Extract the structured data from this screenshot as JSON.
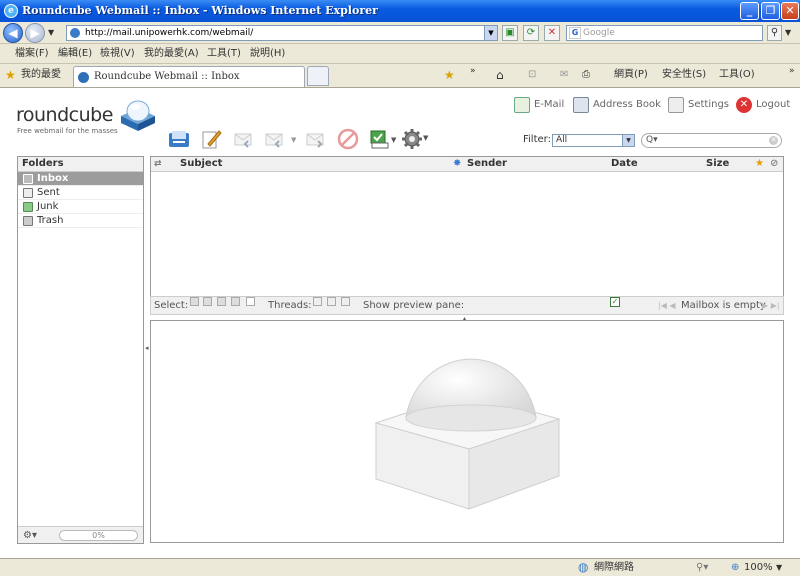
{
  "window": {
    "title": "Roundcube Webmail :: Inbox - Windows Internet Explorer",
    "url": "http://mail.unipowerhk.com/webmail/",
    "search_placeholder": "Google"
  },
  "menu": [
    "檔案(F)",
    "編輯(E)",
    "檢視(V)",
    "我的最愛(A)",
    "工具(T)",
    "說明(H)"
  ],
  "tabs_bar": {
    "favorites_label": "我的最愛",
    "tab_title": "Roundcube Webmail :: Inbox",
    "page_menu": "網頁(P)",
    "safety_menu": "安全性(S)",
    "tools_menu": "工具(O)"
  },
  "app": {
    "logo_name": "roundcube",
    "logo_tagline": "Free webmail for the masses",
    "top_links": {
      "email": "E-Mail",
      "address_book": "Address Book",
      "settings": "Settings",
      "logout": "Logout"
    },
    "filter_label": "Filter:",
    "filter_value": "All",
    "search_value": "Q▾"
  },
  "folders": {
    "header": "Folders",
    "items": [
      {
        "label": "Inbox",
        "selected": true,
        "icon": "inbox-icon"
      },
      {
        "label": "Sent",
        "selected": false,
        "icon": "sent-icon"
      },
      {
        "label": "Junk",
        "selected": false,
        "icon": "junk-icon"
      },
      {
        "label": "Trash",
        "selected": false,
        "icon": "trash-icon"
      }
    ],
    "quota": "0%"
  },
  "message_list": {
    "columns": {
      "subject": "Subject",
      "sender": "Sender",
      "date": "Date",
      "size": "Size"
    },
    "footer": {
      "select_label": "Select:",
      "threads_label": "Threads:",
      "preview_label": "Show preview pane:",
      "preview_checked": true,
      "status": "Mailbox is empty"
    }
  },
  "status_bar": {
    "zone": "網際網路",
    "zoom": "100%"
  },
  "colors": {
    "accent": "#2a6fd6",
    "titlebar": "#0a5ae0",
    "logout_red": "#d33"
  }
}
